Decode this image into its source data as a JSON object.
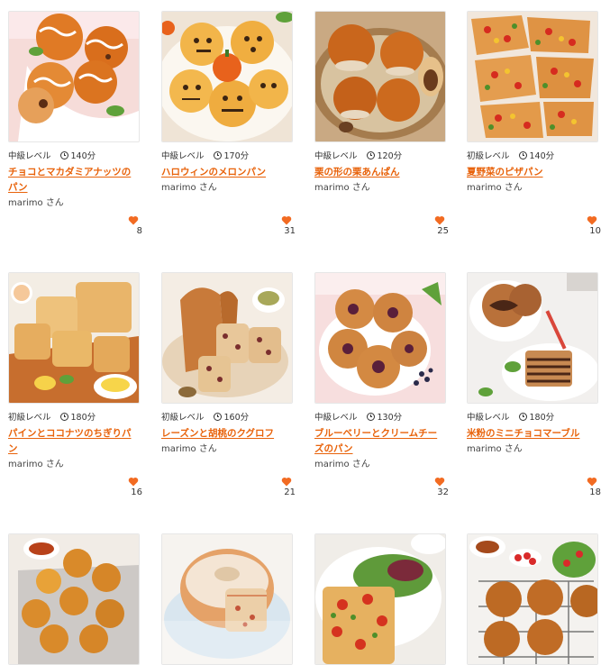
{
  "colors": {
    "accent": "#e8620a",
    "heart": "#f26b22",
    "border": "#e6e6e6"
  },
  "recipes": [
    {
      "level": "中級レベル",
      "time": "140分",
      "title": "チョコとマカダミアナッツのパン",
      "author": "marimo さん",
      "likes": "8"
    },
    {
      "level": "中級レベル",
      "time": "170分",
      "title": "ハロウィンのメロンパン",
      "author": "marimo さん",
      "likes": "31"
    },
    {
      "level": "中級レベル",
      "time": "120分",
      "title": "栗の形の栗あんぱん",
      "author": "marimo さん",
      "likes": "25"
    },
    {
      "level": "初級レベル",
      "time": "140分",
      "title": "夏野菜のピザパン",
      "author": "marimo さん",
      "likes": "10"
    },
    {
      "level": "初級レベル",
      "time": "180分",
      "title": "パインとココナツのちぎりパン",
      "author": "marimo さん",
      "likes": "16"
    },
    {
      "level": "初級レベル",
      "time": "160分",
      "title": "レーズンと胡桃のクグロフ",
      "author": "marimo さん",
      "likes": "21"
    },
    {
      "level": "中級レベル",
      "time": "130分",
      "title": "ブルーベリーとクリームチーズのパン",
      "author": "marimo さん",
      "likes": "32"
    },
    {
      "level": "中級レベル",
      "time": "180分",
      "title": "米粉のミニチョコマーブル",
      "author": "marimo さん",
      "likes": "18"
    },
    {
      "image": "buns-on-rack"
    },
    {
      "image": "powdered-bundt"
    },
    {
      "image": "tomato-focaccia"
    },
    {
      "image": "round-buns-rack"
    }
  ]
}
